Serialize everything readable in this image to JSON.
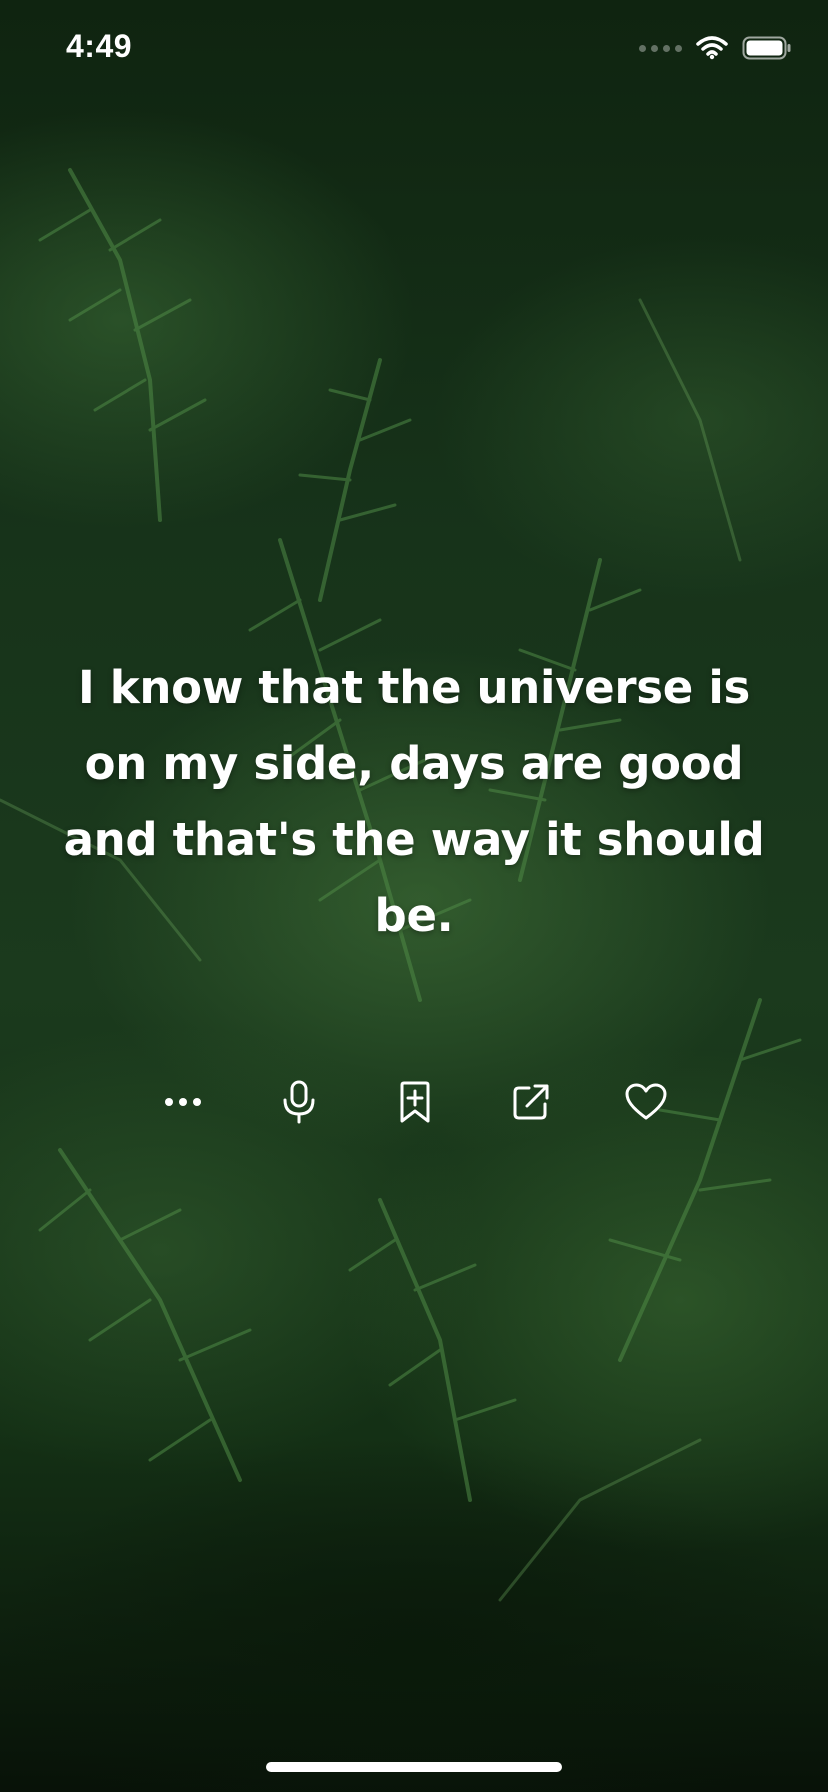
{
  "status_bar": {
    "time": "4:49",
    "wifi_icon": "wifi-icon",
    "battery_icon": "battery-icon"
  },
  "quote": {
    "text": "I know that the universe is on my side, days are good and that's the way it should be."
  },
  "actions": [
    {
      "name": "more-button",
      "icon": "ellipsis-icon"
    },
    {
      "name": "voice-button",
      "icon": "microphone-icon"
    },
    {
      "name": "bookmark-button",
      "icon": "bookmark-add-icon"
    },
    {
      "name": "share-button",
      "icon": "share-icon"
    },
    {
      "name": "favorite-button",
      "icon": "heart-icon"
    }
  ],
  "colors": {
    "foreground": "#ffffff",
    "background_dark": "#0b1a0c",
    "foliage": "#3f7a3a"
  }
}
